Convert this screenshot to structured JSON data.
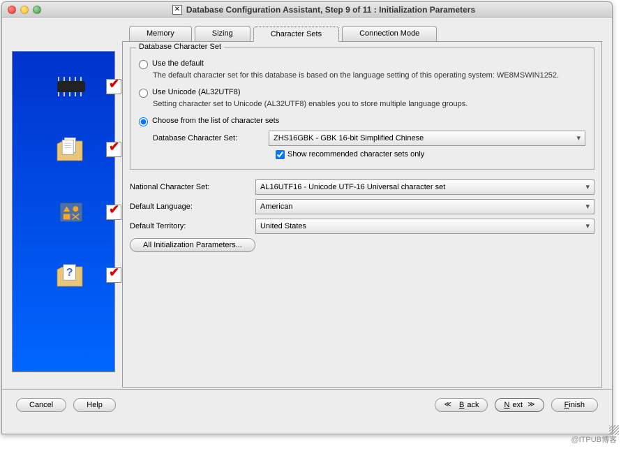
{
  "window": {
    "title": "Database Configuration Assistant, Step 9 of 11 : Initialization Parameters"
  },
  "tabs": {
    "memory": "Memory",
    "sizing": "Sizing",
    "charsets": "Character Sets",
    "connmode": "Connection Mode"
  },
  "fieldset_legend": "Database Character Set",
  "radios": {
    "default_label": "Use the default",
    "default_desc": "The default character set for this database is based on the language setting of this operating system: WE8MSWIN1252.",
    "unicode_label": "Use Unicode (AL32UTF8)",
    "unicode_desc": "Setting character set to Unicode (AL32UTF8) enables you to store multiple language groups.",
    "choose_label": "Choose from the list of character sets"
  },
  "db_charset": {
    "label": "Database Character Set:",
    "value": "ZHS16GBK - GBK 16-bit Simplified Chinese"
  },
  "show_recommended": {
    "label": "Show recommended character sets only",
    "checked": true
  },
  "national_charset": {
    "label": "National Character Set:",
    "value": "AL16UTF16 - Unicode UTF-16 Universal character set"
  },
  "default_language": {
    "label": "Default Language:",
    "value": "American"
  },
  "default_territory": {
    "label": "Default Territory:",
    "value": "United States"
  },
  "all_params_btn": "All Initialization Parameters...",
  "buttons": {
    "cancel": "Cancel",
    "help": "Help",
    "back": "Back",
    "next": "Next",
    "finish": "Finish"
  },
  "watermark": "@ITPUB博客"
}
